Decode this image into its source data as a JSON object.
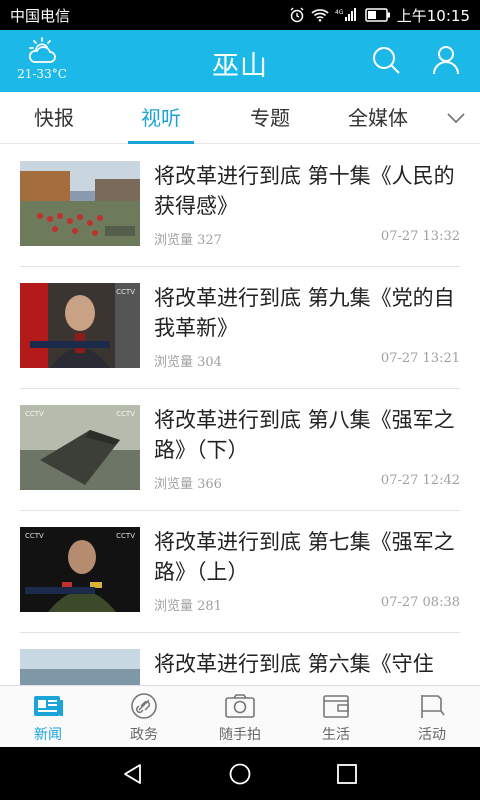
{
  "status_bar": {
    "carrier": "中国电信",
    "network": "4G",
    "time": "上午10:15"
  },
  "header": {
    "temperature": "21-33°C",
    "title": "巫山",
    "weather_icon": "cloudy-sun-icon",
    "search_icon": "search-icon",
    "user_icon": "user-icon",
    "background": "#1cb8e8"
  },
  "tabs": [
    {
      "label": "快报",
      "active": false
    },
    {
      "label": "视听",
      "active": true
    },
    {
      "label": "专题",
      "active": false
    },
    {
      "label": "全媒体",
      "active": false
    }
  ],
  "accent_color": "#1aa4d8",
  "articles": [
    {
      "title": "将改革进行到底 第十集《人民的获得感》",
      "views": "浏览量 327",
      "time": "07-27 13:32"
    },
    {
      "title": "将改革进行到底 第九集《党的自我革新》",
      "views": "浏览量 304",
      "time": "07-27 13:21"
    },
    {
      "title": " 将改革进行到底 第八集《强军之路》（下）",
      "views": "浏览量 366",
      "time": "07-27 12:42"
    },
    {
      "title": "将改革进行到底 第七集《强军之路》（上）",
      "views": "浏览量 281",
      "time": "07-27 08:38"
    },
    {
      "title": "将改革进行到底 第六集《守住",
      "views": "",
      "time": ""
    }
  ],
  "bottom_nav": [
    {
      "label": "新闻",
      "icon": "news-icon",
      "active": true
    },
    {
      "label": "政务",
      "icon": "government-icon",
      "active": false
    },
    {
      "label": "随手拍",
      "icon": "camera-icon",
      "active": false
    },
    {
      "label": "生活",
      "icon": "wallet-icon",
      "active": false
    },
    {
      "label": "活动",
      "icon": "flag-icon",
      "active": false
    }
  ],
  "thumb_logos": {
    "left": "CCTV",
    "right": "CCTV"
  }
}
